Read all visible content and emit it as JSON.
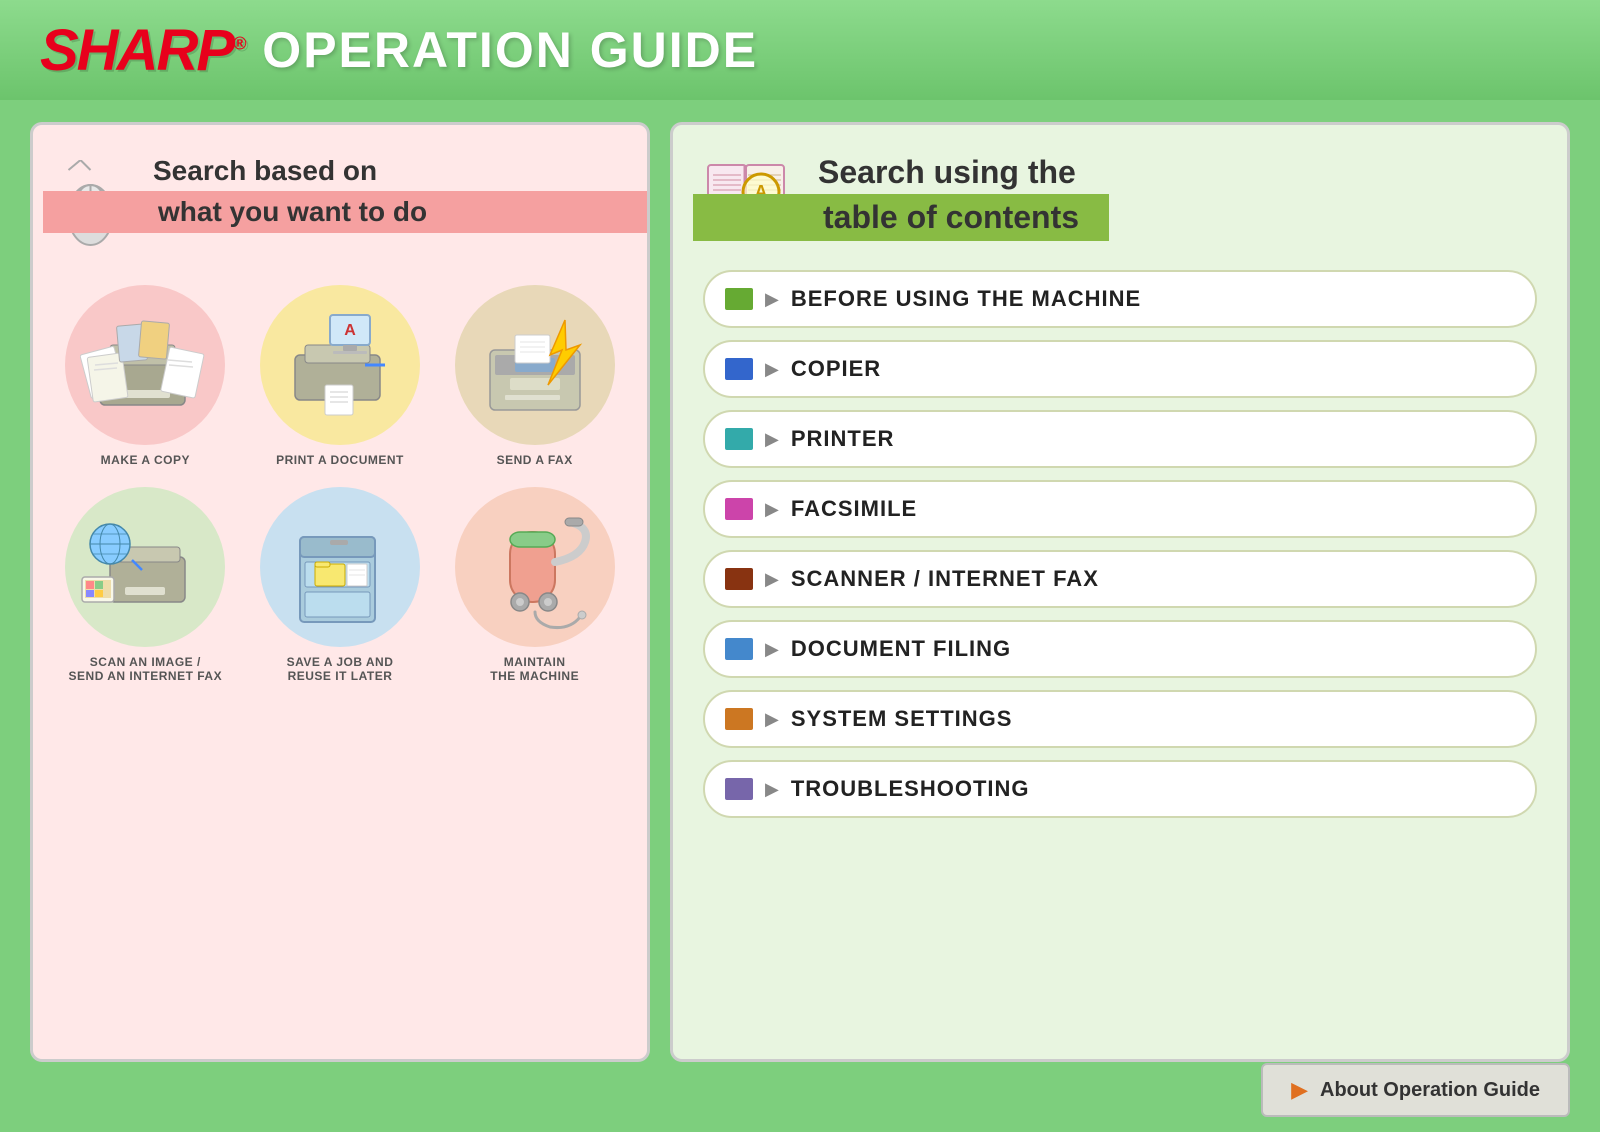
{
  "header": {
    "brand": "SHARP",
    "brand_sup": "®",
    "title": "OPERATION GUIDE"
  },
  "left_panel": {
    "search_title_line1": "Search based on",
    "search_title_line2": "what you want to do",
    "icons": [
      {
        "id": "make-a-copy",
        "label": "MAKE A COPY",
        "bg": "pink"
      },
      {
        "id": "print-a-document",
        "label": "PRINT A DOCUMENT",
        "bg": "yellow"
      },
      {
        "id": "send-a-fax",
        "label": "SEND A FAX",
        "bg": "beige"
      },
      {
        "id": "scan-an-image",
        "label": "SCAN AN IMAGE /\nSEND AN INTERNET FAX",
        "bg": "light-green"
      },
      {
        "id": "save-a-job",
        "label": "SAVE A JOB AND\nREUSE IT LATER",
        "bg": "light-blue"
      },
      {
        "id": "maintain-machine",
        "label": "MAINTAIN\nTHE MACHINE",
        "bg": "light-pink2"
      }
    ]
  },
  "right_panel": {
    "search_title_line1": "Search using the",
    "search_title_line2": "table of contents",
    "menu_items": [
      {
        "id": "before-using",
        "label": "BEFORE USING THE MACHINE",
        "book_color": "book-green"
      },
      {
        "id": "copier",
        "label": "COPIER",
        "book_color": "book-blue"
      },
      {
        "id": "printer",
        "label": "PRINTER",
        "book_color": "book-teal"
      },
      {
        "id": "facsimile",
        "label": "FACSIMILE",
        "book_color": "book-pink"
      },
      {
        "id": "scanner-internet-fax",
        "label": "SCANNER / INTERNET FAX",
        "book_color": "book-darkred"
      },
      {
        "id": "document-filing",
        "label": "DOCUMENT FILING",
        "book_color": "book-lightblue"
      },
      {
        "id": "system-settings",
        "label": "SYSTEM SETTINGS",
        "book_color": "book-orange"
      },
      {
        "id": "troubleshooting",
        "label": "TROUBLESHOOTING",
        "book_color": "book-purple"
      }
    ]
  },
  "footer": {
    "about_label": "About Operation Guide"
  }
}
